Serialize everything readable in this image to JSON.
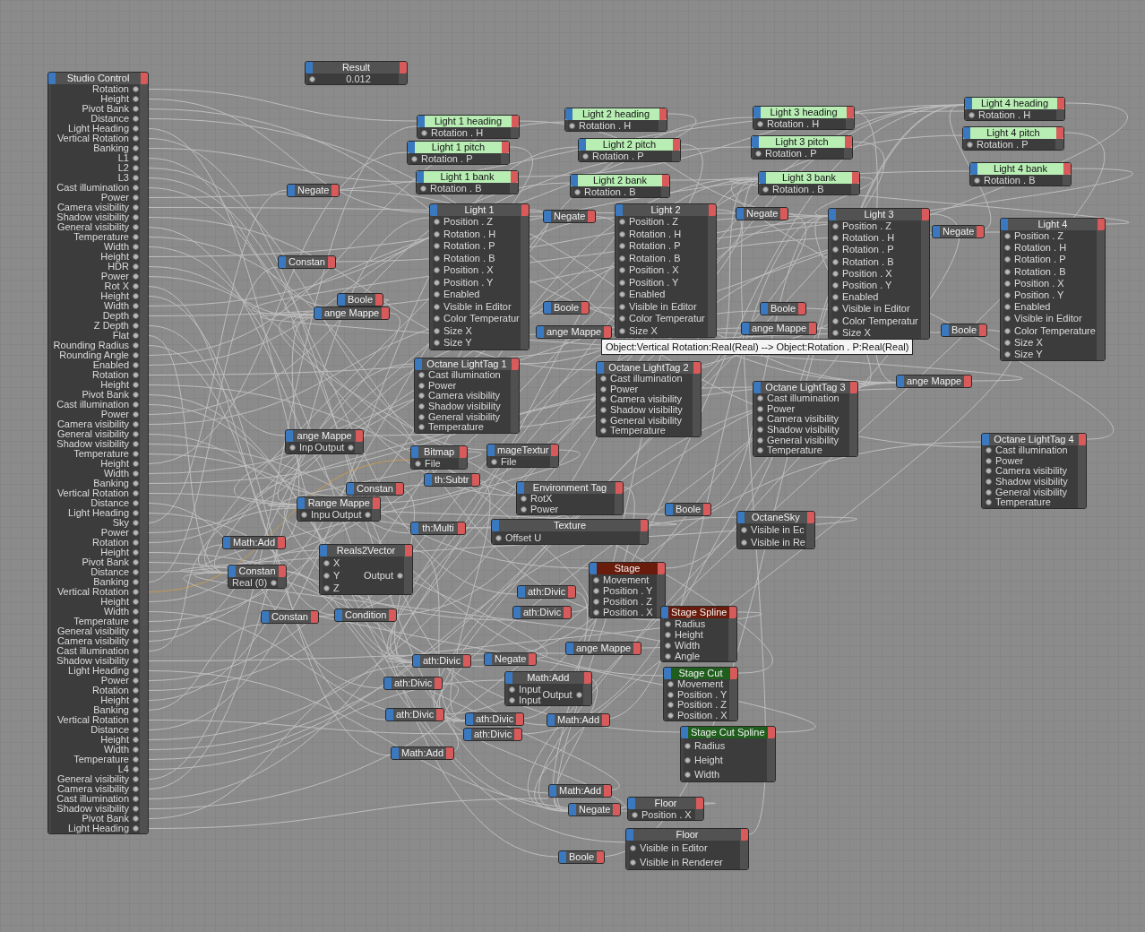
{
  "nodes": [
    {
      "title": "Studio Control",
      "outputs": [
        "Rotation",
        "Height",
        "Pivot Bank",
        "Distance",
        "Light Heading",
        "Vertical Rotation",
        "Banking",
        "L1",
        "L2",
        "L3",
        "Cast illumination",
        "Power",
        "Camera visibility",
        "Shadow visibility",
        "General visibility",
        "Temperature",
        "Width",
        "Height",
        "HDR",
        "Power",
        "Rot X",
        "Height",
        "Width",
        "Depth",
        "Z Depth",
        "Flat",
        "Rounding Radius",
        "Rounding Angle",
        "Enabled",
        "Rotation",
        "Height",
        "Pivot Bank",
        "Cast illumination",
        "Power",
        "Camera visibility",
        "General visibility",
        "Shadow visibility",
        "Temperature",
        "Height",
        "Width",
        "Banking",
        "Vertical Rotation",
        "Distance",
        "Light Heading",
        "Sky",
        "Power",
        "Rotation",
        "Height",
        "Pivot Bank",
        "Distance",
        "Banking",
        "Vertical Rotation",
        "Height",
        "Width",
        "Temperature",
        "General visibility",
        "Camera visibility",
        "Cast illumination",
        "Shadow visibility",
        "Light Heading",
        "Power",
        "Rotation",
        "Height",
        "Banking",
        "Vertical Rotation",
        "Distance",
        "Height",
        "Width",
        "Temperature",
        "L4",
        "General visibility",
        "Camera visibility",
        "Cast illumination",
        "Shadow visibility",
        "Pivot Bank",
        "Light Heading"
      ]
    },
    {
      "title": "Result",
      "value": "0.012"
    },
    {
      "title": "Light 1 heading",
      "color": "#b8eeb4",
      "inputs": [
        "Rotation . H"
      ]
    },
    {
      "title": "Light 2 heading",
      "color": "#b8eeb4",
      "inputs": [
        "Rotation . H"
      ]
    },
    {
      "title": "Light 3 heading",
      "color": "#b8eeb4",
      "inputs": [
        "Rotation . H"
      ]
    },
    {
      "title": "Light 4 heading",
      "color": "#b8eeb4",
      "inputs": [
        "Rotation . H"
      ]
    },
    {
      "title": "Light 1 pitch",
      "color": "#b8eeb4",
      "inputs": [
        "Rotation . P"
      ]
    },
    {
      "title": "Light 2 pitch",
      "color": "#b8eeb4",
      "inputs": [
        "Rotation . P"
      ]
    },
    {
      "title": "Light 3 pitch",
      "color": "#b8eeb4",
      "inputs": [
        "Rotation . P"
      ]
    },
    {
      "title": "Light 4 pitch",
      "color": "#b8eeb4",
      "inputs": [
        "Rotation . P"
      ]
    },
    {
      "title": "Light 1 bank",
      "color": "#b8eeb4",
      "inputs": [
        "Rotation . B"
      ]
    },
    {
      "title": "Light 2 bank",
      "color": "#b8eeb4",
      "inputs": [
        "Rotation . B"
      ]
    },
    {
      "title": "Light 3 bank",
      "color": "#b8eeb4",
      "inputs": [
        "Rotation . B"
      ]
    },
    {
      "title": "Light 4 bank",
      "color": "#b8eeb4",
      "inputs": [
        "Rotation . B"
      ]
    },
    {
      "title": "Negate"
    },
    {
      "title": "Light 1",
      "inputs": [
        "Position . Z",
        "Rotation . H",
        "Rotation . P",
        "Rotation . B",
        "Position . X",
        "Position . Y",
        "Enabled",
        "Visible in Editor",
        "Color Temperatur",
        "Size X",
        "Size Y"
      ]
    },
    {
      "title": "Negate"
    },
    {
      "title": "Light 2",
      "inputs": [
        "Position . Z",
        "Rotation . H",
        "Rotation . P",
        "Rotation . B",
        "Position . X",
        "Position . Y",
        "Enabled",
        "Visible in Editor",
        "Color Temperatur",
        "Size X"
      ]
    },
    {
      "title": "Negate"
    },
    {
      "title": "Light 3",
      "inputs": [
        "Position . Z",
        "Rotation . H",
        "Rotation . P",
        "Rotation . B",
        "Position . X",
        "Position . Y",
        "Enabled",
        "Visible in Editor",
        "Color Temperatur",
        "Size X"
      ]
    },
    {
      "title": "Negate"
    },
    {
      "title": "Light 4",
      "inputs": [
        "Position . Z",
        "Rotation . H",
        "Rotation . P",
        "Rotation . B",
        "Position . X",
        "Position . Y",
        "Enabled",
        "Visible in Editor",
        "Color Temperature",
        "Size X",
        "Size Y"
      ]
    },
    {
      "title": "Constan"
    },
    {
      "title": "Boole"
    },
    {
      "title": "Boole"
    },
    {
      "title": "Boole"
    },
    {
      "title": "ange Mappe"
    },
    {
      "title": "ange Mappe"
    },
    {
      "title": "ange Mappe"
    },
    {
      "title": "Boole"
    },
    {
      "title": "Octane LightTag 1",
      "inputs": [
        "Cast illumination",
        "Power",
        "Camera visibility",
        "Shadow visibility",
        "General visibility",
        "Temperature"
      ]
    },
    {
      "title": "Octane LightTag 2",
      "inputs": [
        "Cast illumination",
        "Power",
        "Camera visibility",
        "Shadow visibility",
        "General visibility",
        "Temperature"
      ]
    },
    {
      "title": "Octane LightTag 3",
      "inputs": [
        "Cast illumination",
        "Power",
        "Camera visibility",
        "Shadow visibility",
        "General visibility",
        "Temperature"
      ]
    },
    {
      "title": "ange Mappe"
    },
    {
      "title": "ange Mappe",
      "inputs": [
        "Inp"
      ],
      "outputs": [
        "Output"
      ]
    },
    {
      "title": "Bitmap",
      "inputs": [
        "File"
      ]
    },
    {
      "title": "mageTextur",
      "inputs": [
        "File"
      ]
    },
    {
      "title": "Constan"
    },
    {
      "title": "th:Subtr"
    },
    {
      "title": "Environment Tag",
      "inputs": [
        "RotX",
        "Power"
      ]
    },
    {
      "title": "Range Mappe",
      "inputs": [
        "Inpu"
      ],
      "outputs": [
        "Output"
      ]
    },
    {
      "title": "Octane LightTag 4",
      "inputs": [
        "Cast illumination",
        "Power",
        "Camera visibility",
        "Shadow visibility",
        "General visibility",
        "Temperature"
      ]
    },
    {
      "title": "Boole"
    },
    {
      "title": "Math:Add"
    },
    {
      "title": "th:Multi"
    },
    {
      "title": "Texture",
      "inputs": [
        "Offset U"
      ]
    },
    {
      "title": "OctaneSky",
      "inputs": [
        "Visible in Ec",
        "Visible in Re"
      ]
    },
    {
      "title": "Constan",
      "outputs": [
        "Real (0)"
      ]
    },
    {
      "title": "Reals2Vector",
      "inputs": [
        "X",
        "Y",
        "Z"
      ],
      "outputs": [
        "Output"
      ]
    },
    {
      "title": "ath:Divic"
    },
    {
      "title": "Stage",
      "color": "#6a1c0c",
      "inputs": [
        "Movement",
        "Position . Y",
        "Position . Z",
        "Position . X"
      ]
    },
    {
      "title": "Constan"
    },
    {
      "title": "Condition"
    },
    {
      "title": "ath:Divic"
    },
    {
      "title": "ath:Divic"
    },
    {
      "title": "Negate"
    },
    {
      "title": "ange Mappe"
    },
    {
      "title": "Stage Spline",
      "color": "#6a1c0c",
      "inputs": [
        "Radius",
        "Height",
        "Width",
        "Angle"
      ]
    },
    {
      "title": "ath:Divic"
    },
    {
      "title": "Math:Add",
      "inputs": [
        "Input",
        "Input"
      ],
      "outputs": [
        "Output"
      ]
    },
    {
      "title": "ath:Divic"
    },
    {
      "title": "ath:Divic"
    },
    {
      "title": "Math:Add"
    },
    {
      "title": "Stage Cut",
      "color": "#1f5e1c",
      "inputs": [
        "Movement",
        "Position . Y",
        "Position . Z",
        "Position . X"
      ]
    },
    {
      "title": "ath:Divic"
    },
    {
      "title": "Math:Add"
    },
    {
      "title": "Stage Cut Spline",
      "color": "#1f5e1c",
      "inputs": [
        "Radius",
        "Height",
        "Width"
      ]
    },
    {
      "title": "Math:Add"
    },
    {
      "title": "Negate"
    },
    {
      "title": "Floor",
      "inputs": [
        "Position . X"
      ]
    },
    {
      "title": "Boole"
    },
    {
      "title": "Floor",
      "inputs": [
        "Visible in Editor",
        "Visible in Renderer"
      ]
    }
  ],
  "tooltip": {
    "text": "Object:Vertical Rotation:Real(Real) --> Object:Rotation . P:Real(Real)"
  }
}
